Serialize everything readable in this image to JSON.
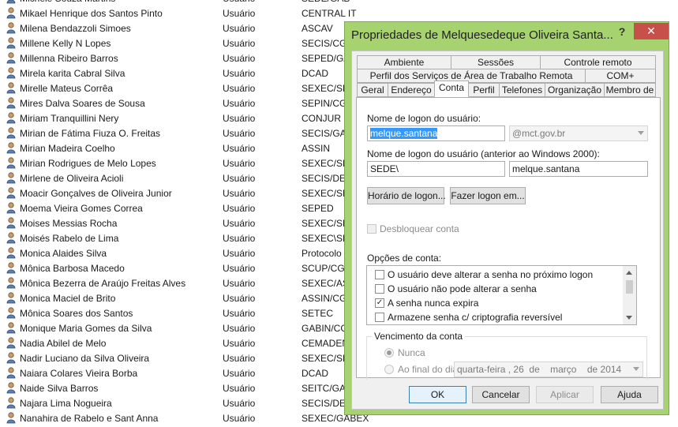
{
  "users": [
    {
      "name": "Michele Souza Martins",
      "type": "Usuário",
      "dept": "SEDE/GAB"
    },
    {
      "name": "Mikael Henrique dos Santos Pinto",
      "type": "Usuário",
      "dept": "CENTRAL IT"
    },
    {
      "name": "Milena Bendazzoli Simoes",
      "type": "Usuário",
      "dept": "ASCAV"
    },
    {
      "name": "Millene Kelly N Lopes",
      "type": "Usuário",
      "dept": "SECIS/CGA"
    },
    {
      "name": "Millenna Ribeiro Barros",
      "type": "Usuário",
      "dept": "SEPED/GAB"
    },
    {
      "name": "Mirela karita Cabral Silva",
      "type": "Usuário",
      "dept": "DCAD"
    },
    {
      "name": "Mirelle Mateus Corrêa",
      "type": "Usuário",
      "dept": "SEXEC/SPC"
    },
    {
      "name": "Mires Dalva Soares de Sousa",
      "type": "Usuário",
      "dept": "SEPIN/CGC"
    },
    {
      "name": "Miriam Tranquillini Nery",
      "type": "Usuário",
      "dept": "CONJUR"
    },
    {
      "name": "Mirian de Fátima Fiuza O. Freitas",
      "type": "Usuário",
      "dept": "SECIS/GAB"
    },
    {
      "name": "Mirian Madeira Coelho",
      "type": "Usuário",
      "dept": "ASSIN"
    },
    {
      "name": "Mirian Rodrigues de Melo Lopes",
      "type": "Usuário",
      "dept": "SEXEC/SPC"
    },
    {
      "name": "Mirlene de Oliveira Acioli",
      "type": "Usuário",
      "dept": "SECIS/DEA"
    },
    {
      "name": "Moacir Gonçalves de Oliveira Junior",
      "type": "Usuário",
      "dept": "SEXEC/SPC"
    },
    {
      "name": "Moema Vieira Gomes Correa",
      "type": "Usuário",
      "dept": "SEPED"
    },
    {
      "name": "Moises Messias Rocha",
      "type": "Usuário",
      "dept": "SEXEC/SPC"
    },
    {
      "name": "Moisés Rabelo de Lima",
      "type": "Usuário",
      "dept": "SEXEC\\SPC"
    },
    {
      "name": "Monica Alaides Silva",
      "type": "Usuário",
      "dept": "Protocolo"
    },
    {
      "name": "Mônica Barbosa Macedo",
      "type": "Usuário",
      "dept": "SCUP/CGU"
    },
    {
      "name": "Mônica Bezerra de Araújo Freitas Alves",
      "type": "Usuário",
      "dept": "SEXEC/ASC"
    },
    {
      "name": "Monica Maciel de Brito",
      "type": "Usuário",
      "dept": "ASSIN/CG"
    },
    {
      "name": "Mônica Soares dos Santos",
      "type": "Usuário",
      "dept": "SETEC"
    },
    {
      "name": "Monique Maria Gomes da Silva",
      "type": "Usuário",
      "dept": "GABIN/CG"
    },
    {
      "name": "Nadia Abilel de Melo",
      "type": "Usuário",
      "dept": "CEMADEN"
    },
    {
      "name": "Nadir Luciano da Silva Oliveira",
      "type": "Usuário",
      "dept": "SEXEC/SPC"
    },
    {
      "name": "Naiara Colares Vieira Borba",
      "type": "Usuário",
      "dept": "DCAD"
    },
    {
      "name": "Naide Silva Barros",
      "type": "Usuário",
      "dept": "SEITC/GAB"
    },
    {
      "name": "Najara Lima Nogueira",
      "type": "Usuário",
      "dept": "SECIS/DEP"
    },
    {
      "name": "Nanahira de Rabelo e Sant Anna",
      "type": "Usuário",
      "dept": "SEXEC/GABEX"
    }
  ],
  "dialog": {
    "title": "Propriedades de Melquesedeque Oliveira Santa...",
    "help_label": "?",
    "close_label": "✕",
    "tabs_row1": [
      "Ambiente",
      "Sessões",
      "Controle remoto"
    ],
    "tabs_row2": [
      "Perfil dos Serviços de Área de Trabalho Remota",
      "COM+"
    ],
    "tabs_row3": [
      "Geral",
      "Endereço",
      "Conta",
      "Perfil",
      "Telefones",
      "Organização",
      "Membro de"
    ],
    "active_tab": "Conta",
    "logon_name_label": "Nome de logon do usuário:",
    "logon_name_value": "melque.santana",
    "domain_suffix": "@mct.gov.br",
    "pre2000_label": "Nome de logon do usuário (anterior ao Windows 2000):",
    "pre2000_domain": "SEDE\\",
    "pre2000_user": "melque.santana",
    "logon_hours_button": "Horário de logon...",
    "logon_to_button": "Fazer logon em...",
    "unlock_label": "Desbloquear conta",
    "options_label": "Opções de conta:",
    "options": [
      {
        "label": "O usuário deve alterar a senha no próximo logon",
        "checked": false
      },
      {
        "label": "O usuário não pode alterar a senha",
        "checked": false
      },
      {
        "label": "A senha nunca expira",
        "checked": true
      },
      {
        "label": "Armazene senha c/ criptografia reversível",
        "checked": false
      }
    ],
    "expiry_group": "Vencimento da conta",
    "never_label": "Nunca",
    "end_of_label": "Ao final do dia:",
    "date_weekday": "quarta-feira",
    "date_day": "26",
    "date_de1": "de",
    "date_month": "março",
    "date_de2": "de",
    "date_year": "2014",
    "ok_label": "OK",
    "cancel_label": "Cancelar",
    "apply_label": "Aplicar",
    "help_button_label": "Ajuda"
  },
  "colors": {
    "titlebar": "#a6d36f",
    "close": "#c7504a",
    "selection": "#3399ff"
  }
}
